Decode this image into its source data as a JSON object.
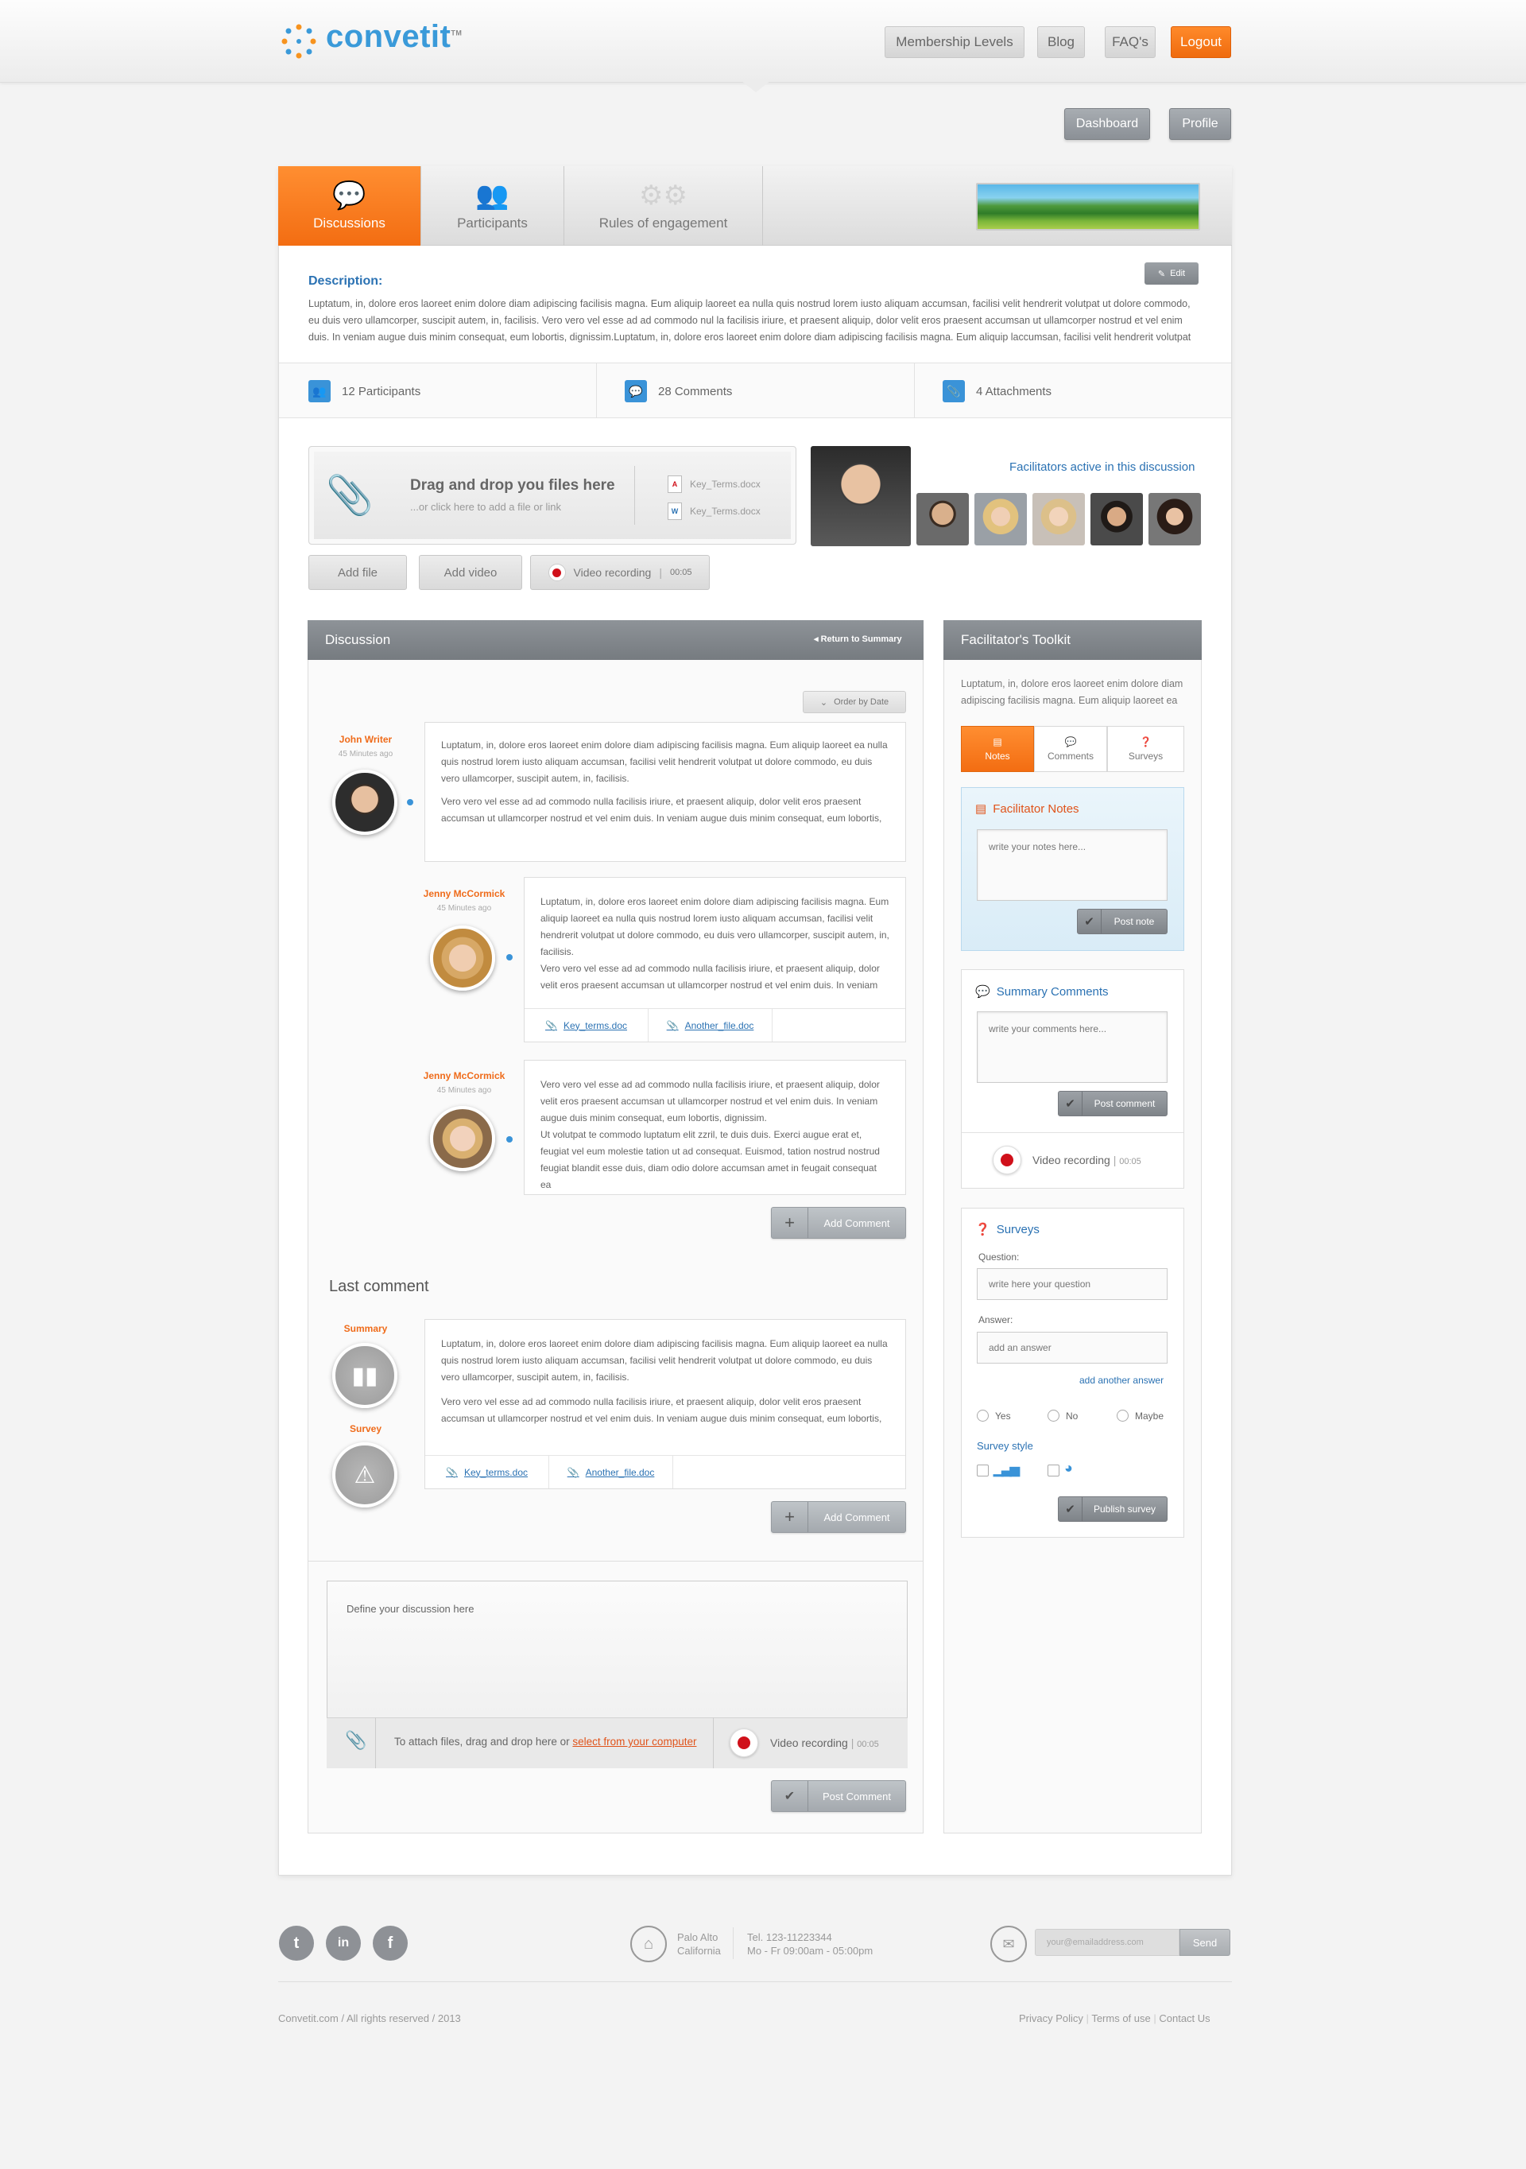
{
  "header": {
    "logo_text": "convetit",
    "logo_tm": "TM",
    "nav": [
      "Membership Levels",
      "Blog",
      "FAQ's",
      "Logout"
    ]
  },
  "subnav": [
    "Dashboard",
    "Profile"
  ],
  "tabs": [
    {
      "label": "Discussions",
      "icon": "speech-bubbles-icon"
    },
    {
      "label": "Participants",
      "icon": "people-icon"
    },
    {
      "label": "Rules of engagement",
      "icon": "gears-icon"
    }
  ],
  "description": {
    "title": "Description:",
    "edit_label": "Edit",
    "text": "Luptatum, in, dolore eros laoreet enim dolore diam adipiscing facilisis magna. Eum aliquip laoreet ea nulla quis nostrud lorem iusto aliquam accumsan, facilisi velit hendrerit volutpat ut dolore commodo, eu duis vero ullamcorper, suscipit autem, in, facilisis. Vero vero vel esse ad ad commodo nul la facilisis iriure, et praesent aliquip, dolor velit eros praesent accumsan ut ullamcorper nostrud et vel enim duis. In veniam augue duis minim consequat, eum lobortis, dignissim.Luptatum, in, dolore eros laoreet enim dolore diam adipiscing facilisis magna. Eum aliquip laccumsan, facilisi velit hendrerit volutpat"
  },
  "stats": [
    "12 Participants",
    "28 Comments",
    "4 Attachments"
  ],
  "upload": {
    "title": "Drag and drop you files here",
    "subtitle": "...or click here to add a file or link",
    "files": [
      "Key_Terms.docx",
      "Key_Terms.docx"
    ],
    "add_file": "Add file",
    "add_video": "Add video",
    "video_recording": "Video recording",
    "timer": "00:05"
  },
  "facilitators_label": "Facilitators active in this discussion",
  "discussion": {
    "title": "Discussion",
    "return_link": "Return to Summary",
    "order_by": "Order by Date",
    "comments": [
      {
        "author": "John Writer",
        "ago": "45 Minutes ago",
        "p1": "Luptatum, in, dolore eros laoreet enim dolore diam adipiscing facilisis magna. Eum aliquip laoreet ea nulla quis nostrud lorem iusto aliquam accumsan, facilisi velit hendrerit volutpat ut dolore commodo, eu duis vero ullamcorper, suscipit autem, in, facilisis.",
        "p2": "Vero vero vel esse ad ad commodo nulla facilisis iriure, et praesent aliquip, dolor velit eros praesent accumsan ut ullamcorper nostrud et vel enim duis. In veniam augue duis minim consequat, eum lobortis,"
      },
      {
        "author": "Jenny McCormick",
        "ago": "45 Minutes ago",
        "p1": "Luptatum, in, dolore eros laoreet enim dolore diam adipiscing facilisis magna. Eum aliquip laoreet ea nulla quis nostrud lorem iusto aliquam accumsan, facilisi velit hendrerit volutpat ut dolore commodo, eu duis vero ullamcorper, suscipit autem, in, facilisis.",
        "p2": "Vero vero vel esse ad ad commodo nulla facilisis iriure, et praesent aliquip, dolor velit eros praesent accumsan ut ullamcorper nostrud et vel enim duis. In veniam",
        "attachments": [
          "Key_terms.doc",
          "Another_file.doc"
        ]
      },
      {
        "author": "Jenny McCormick",
        "ago": "45 Minutes ago",
        "p1": "Vero vero vel esse ad ad commodo nulla facilisis iriure, et praesent aliquip, dolor velit eros praesent accumsan ut ullamcorper nostrud et vel enim duis. In veniam augue duis minim consequat, eum lobortis, dignissim.",
        "p2": "Ut volutpat te commodo luptatum elit zzril, te duis duis. Exerci augue erat et, feugiat vel eum molestie tation ut ad consequat. Euismod, tation nostrud nostrud feugiat blandit esse duis, diam odio dolore accumsan amet in feugait consequat ea"
      }
    ],
    "add_comment": "Add Comment",
    "last_comment_title": "Last comment",
    "summary_label": "Summary",
    "survey_label": "Survey",
    "last_comment": {
      "p1": "Luptatum, in, dolore eros laoreet enim dolore diam adipiscing facilisis magna. Eum aliquip laoreet ea nulla quis nostrud lorem iusto aliquam accumsan, facilisi velit hendrerit volutpat ut dolore commodo, eu duis vero ullamcorper, suscipit autem, in, facilisis.",
      "p2": "Vero vero vel esse ad ad commodo nulla facilisis iriure, et praesent aliquip, dolor velit eros praesent accumsan ut ullamcorper nostrud et vel enim duis. In veniam augue duis minim consequat, eum lobortis,",
      "attachments": [
        "Key_terms.doc",
        "Another_file.doc"
      ]
    },
    "define_placeholder": "Define your discussion here",
    "attach_text": "To attach files, drag and drop here or",
    "attach_link": "select from your computer",
    "post_comment": "Post Comment"
  },
  "toolkit": {
    "title": "Facilitator's Toolkit",
    "intro": "Luptatum, in, dolore eros laoreet enim dolore diam adipiscing facilisis magna. Eum aliquip laoreet ea",
    "tabs": [
      "Notes",
      "Comments",
      "Surveys"
    ],
    "notes_title": "Facilitator Notes",
    "notes_placeholder": "write your notes here...",
    "post_note": "Post note",
    "summary_title": "Summary Comments",
    "summary_placeholder": "write your comments here...",
    "post_comment": "Post comment",
    "video_recording": "Video recording",
    "timer": "00:05",
    "surveys_title": "Surveys",
    "question_label": "Question:",
    "question_placeholder": "write here your question",
    "answer_label": "Answer:",
    "answer_placeholder": "add an answer",
    "add_answer": "add another answer",
    "options": [
      "Yes",
      "No",
      "Maybe"
    ],
    "style_label": "Survey style",
    "publish": "Publish survey"
  },
  "footer": {
    "social": [
      "twitter-icon",
      "linkedin-icon",
      "facebook-icon"
    ],
    "city": "Palo Alto",
    "state": "California",
    "tel": "Tel. 123-11223344",
    "hours": "Mo - Fr 09:00am - 05:00pm",
    "email_placeholder": "your@emailaddress.com",
    "send": "Send",
    "copyright": "Convetit.com / All rights reserved / 2013",
    "links": [
      "Privacy Policy",
      "Terms of use",
      "Contact Us"
    ]
  },
  "colors": {
    "accent": "#f36d12",
    "blue": "#2b72b3",
    "gray_header": "#7f8489"
  }
}
